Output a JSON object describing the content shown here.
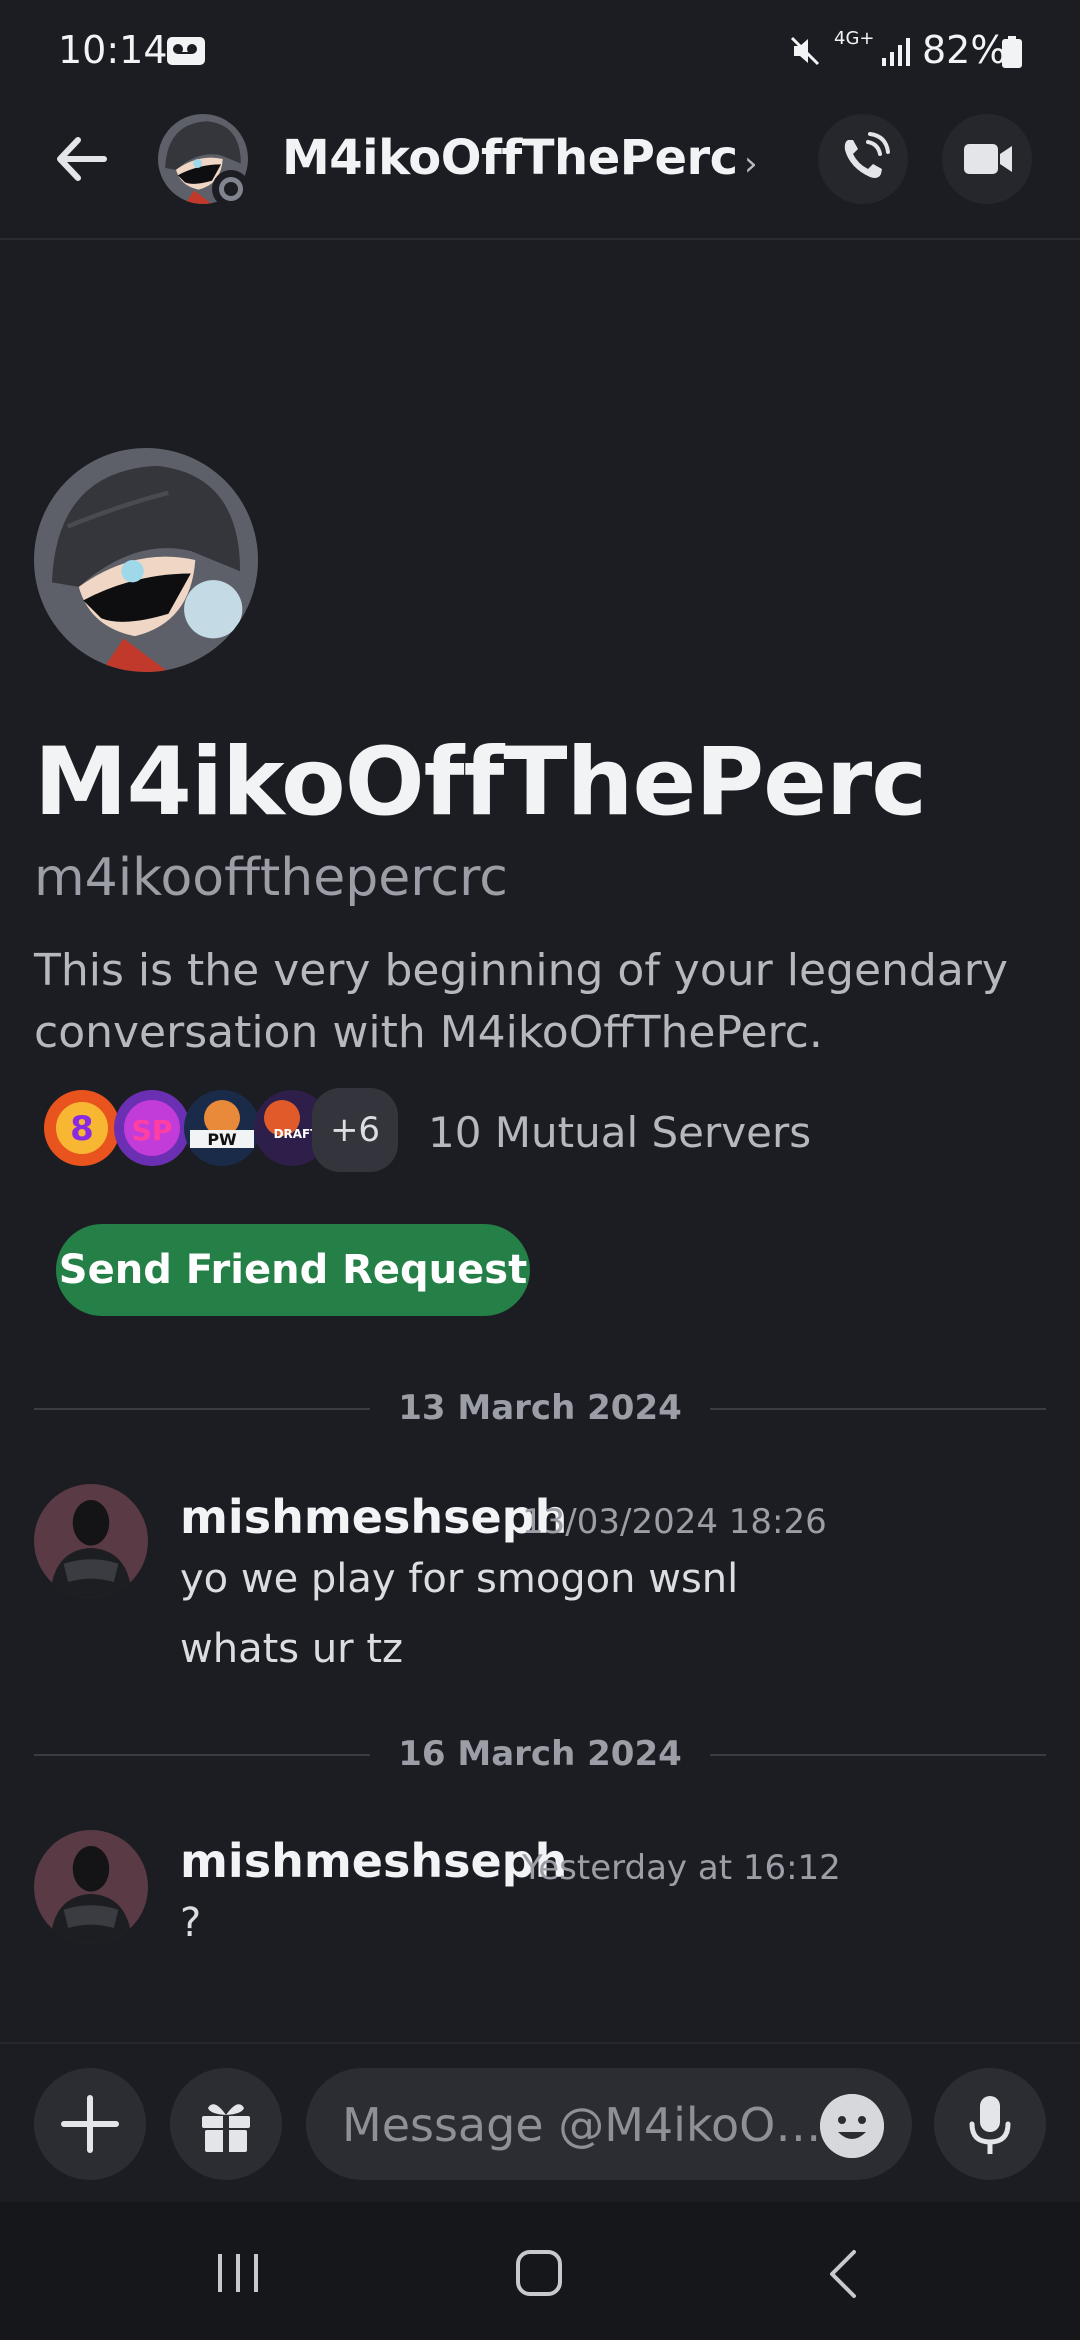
{
  "status_bar": {
    "time": "10:14",
    "network": "4G+",
    "battery_percent": "82%",
    "icons": [
      "voicemail-icon",
      "mute-icon",
      "signal-icon",
      "battery-icon"
    ]
  },
  "header": {
    "name": "M4ikoOffThePerc",
    "chevron": "›",
    "icons": [
      "back-arrow-icon",
      "phone-call-icon",
      "video-camera-icon"
    ]
  },
  "profile": {
    "display_name": "M4ikoOffThePerc",
    "username": "m4ikooffthepercrc",
    "intro_line1": "This is the very beginning of your legendary",
    "intro_line2": "conversation with M4ikoOffThePerc.",
    "mutual_extra": "+6",
    "mutual_label": "10 Mutual Servers",
    "friend_button": "Send Friend Request"
  },
  "messages": {
    "date1": "13 March 2024",
    "group1": {
      "author": "mishmeshseph",
      "timestamp": "13/03/2024 18:26",
      "lines": [
        "yo we play for smogon wsnl",
        "whats ur tz"
      ]
    },
    "date2": "16 March 2024",
    "group2": {
      "author": "mishmeshseph",
      "timestamp": "Yesterday at 16:12",
      "lines": [
        "?"
      ]
    }
  },
  "composer": {
    "placeholder": "Message @M4ikoO…",
    "icons": [
      "plus-icon",
      "gift-icon",
      "emoji-icon",
      "microphone-icon"
    ]
  },
  "colors": {
    "background": "#1c1d22",
    "friend_button": "#248046",
    "muted_text": "#9b9ea6"
  }
}
